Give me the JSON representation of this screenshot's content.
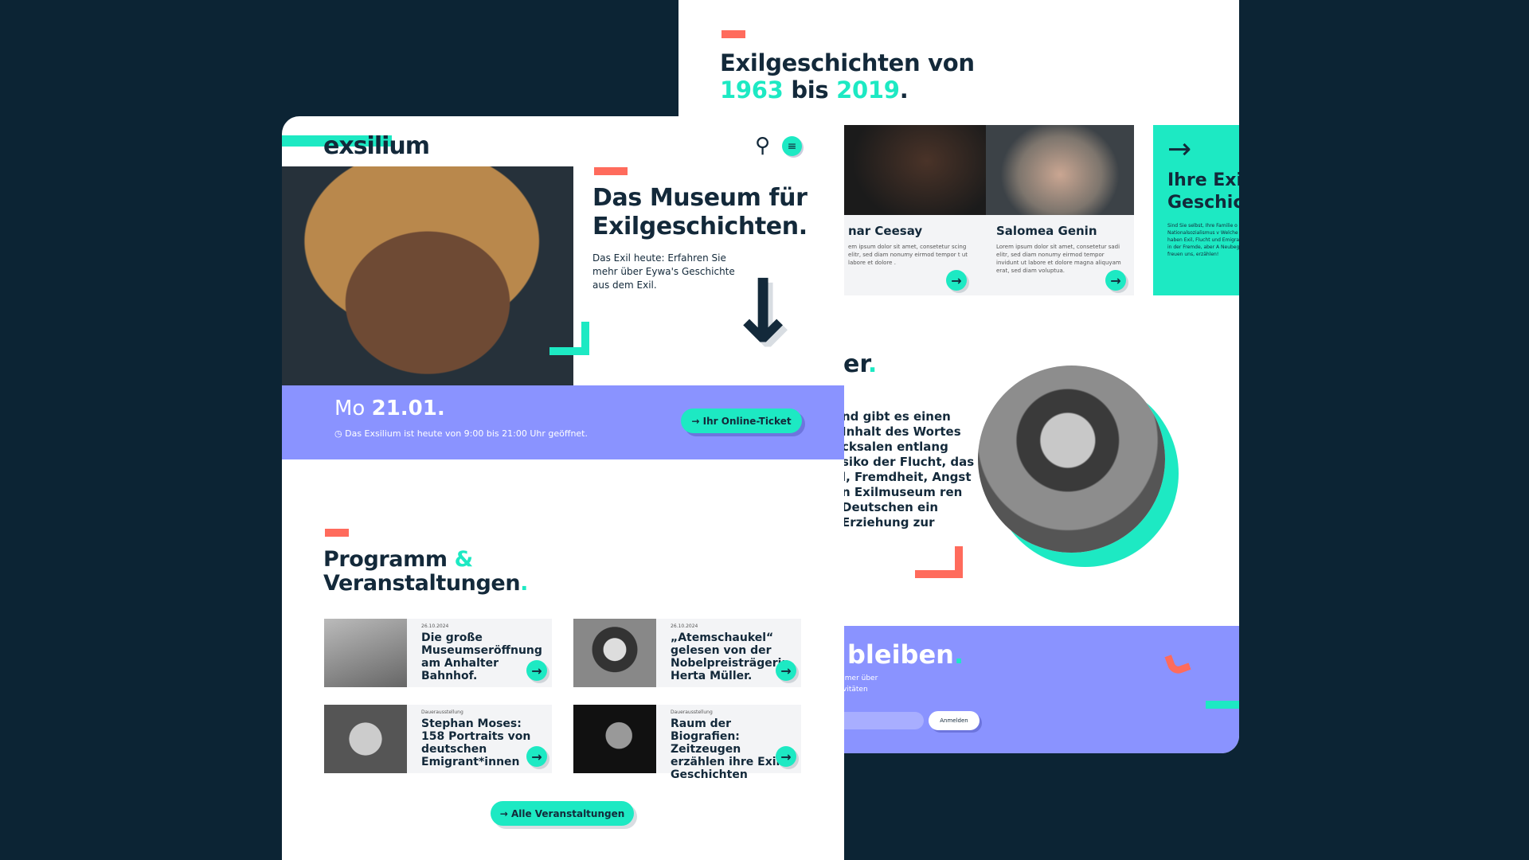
{
  "back_page": {
    "title_line1": "Exilgeschichten von",
    "year_start": "1963",
    "title_bis": "bis",
    "year_end": "2019",
    "title_dot": ".",
    "cards": [
      {
        "name": "nar Ceesay",
        "text": "em ipsum dolor sit amet, consetetur scing elitr, sed diam nonumy eirmod tempor t ut labore et dolore ."
      },
      {
        "name": "Salomea Genin",
        "text": "Lorem ipsum dolor sit amet, consetetur sadi elitr, sed diam nonumy eirmod tempor invidunt ut labore et dolore magna aliquyam erat, sed diam voluptua."
      }
    ],
    "teal_card": {
      "arrow": "→",
      "title_line1": "Ihre Exi",
      "title_line2": "Geschic",
      "text": "Sind Sie selbst, Ihre Familie o vor dem Nationalsozialismus v Welche Geschichten haben Exil, Flucht und Emigration. Leben in der Fremde, aber A Neubeginn? Wir freuen uns, erzählen!"
    },
    "section_head": "er",
    "section_dot": ".",
    "quote": "nd gibt es einen Inhalt des Wortes cksalen entlang siko der Flucht, das l, Fremdheit, Angst n Exilmuseum ren Deutschen ein Erziehung zur",
    "newsletter": {
      "title": "bleiben",
      "dot": ".",
      "text_line1": "mmer über",
      "text_line2": "tivitäten",
      "button": "Anmelden"
    }
  },
  "front_page": {
    "logo": "exsilium",
    "hero": {
      "title_line1": "Das Museum für",
      "title_line2": "Exilgeschichten.",
      "subtitle": "Das Exil heute: Erfahren Sie mehr über Eywa's Geschichte aus dem Exil."
    },
    "date_band": {
      "day": "Mo",
      "date": "21.01.",
      "hours": "Das Exsilium ist heute von 9:00 bis 21:00 Uhr geöffnet.",
      "ticket_button": "Ihr Online-Ticket"
    },
    "program": {
      "title_line1": "Programm",
      "ampersand": "&",
      "title_line2": "Veranstaltungen",
      "dot": "."
    },
    "events": [
      {
        "date": "26.10.2024",
        "title": "Die große Museumseröffnung am Anhalter Bahnhof."
      },
      {
        "date": "26.10.2024",
        "title": "„Atemschaukel“ gelesen von der Nobelpreisträgerin Herta Müller."
      },
      {
        "date": "Dauerausstellung",
        "title": "Stephan Moses: 158 Portraits von deutschen Emigrant*innen"
      },
      {
        "date": "Dauerausstellung",
        "title": "Raum der Biografien: Zeitzeugen erzählen ihre Exil Geschichten"
      }
    ],
    "all_events_button": "Alle Veranstaltungen"
  },
  "colors": {
    "navy": "#0c2434",
    "mint": "#1de9c3",
    "coral": "#ff6b5c",
    "periwinkle": "#8a93ff"
  }
}
